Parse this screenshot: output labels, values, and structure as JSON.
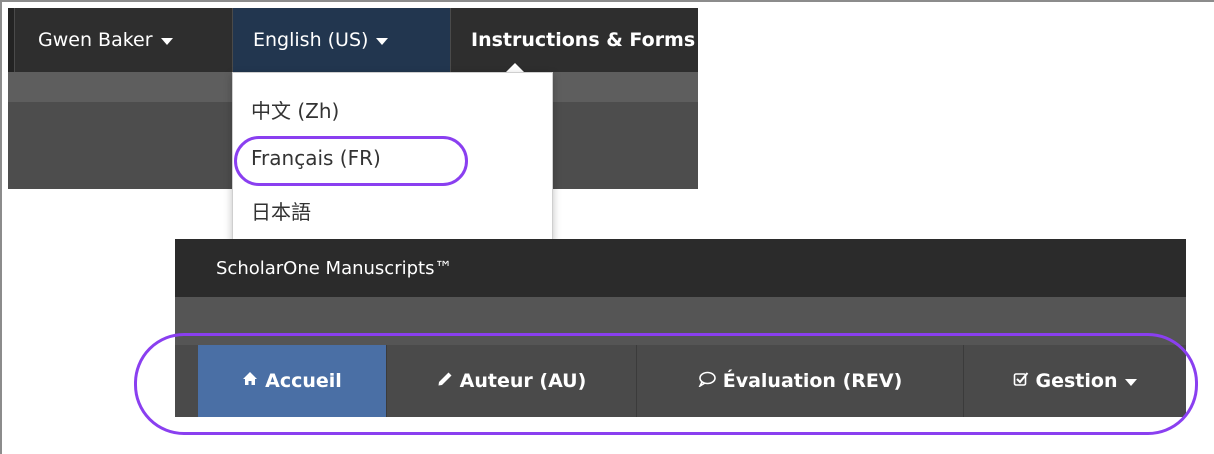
{
  "top": {
    "user_label": "Gwen Baker",
    "language_label": "English (US)",
    "instructions_label": "Instructions & Forms"
  },
  "language_menu": {
    "items": [
      "中文 (Zh)",
      "Français (FR)",
      "日本語"
    ],
    "highlighted_index": 1
  },
  "bottom": {
    "brand": "ScholarOne Manuscripts™",
    "nav": [
      {
        "label": "Accueil",
        "icon": "home-icon"
      },
      {
        "label": "Auteur (AU)",
        "icon": "pencil-icon"
      },
      {
        "label": "Évaluation (REV)",
        "icon": "speech-bubble-icon"
      },
      {
        "label": "Gestion",
        "icon": "checkbox-icon"
      }
    ]
  },
  "colors": {
    "highlight": "#8a3ff0",
    "active_tab": "#4a6fa5",
    "language_active": "#22364f"
  }
}
